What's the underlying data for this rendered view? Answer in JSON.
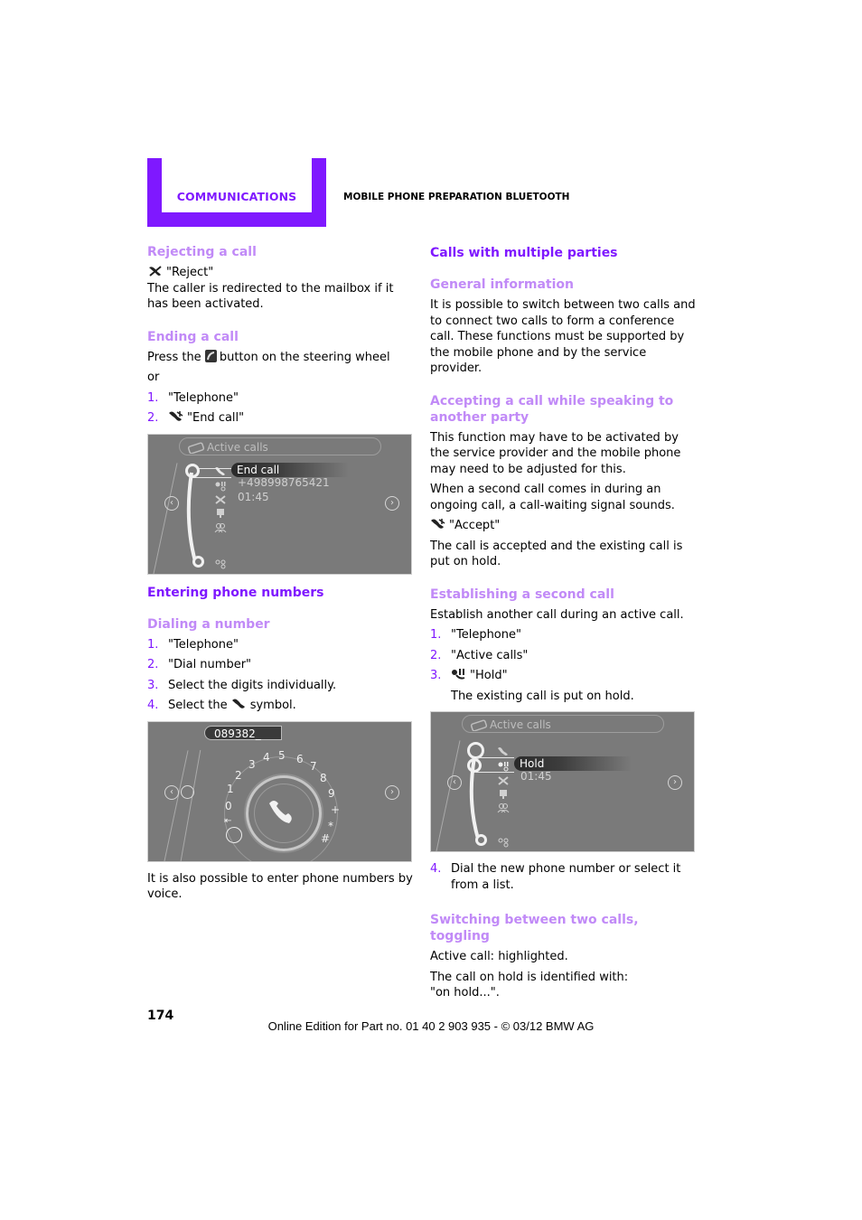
{
  "header": {
    "section": "COMMUNICATIONS",
    "chapter": "MOBILE PHONE PREPARATION BLUETOOTH",
    "accent_color": "#7f18ff",
    "subheading_color": "#c18af7"
  },
  "left": {
    "rejecting": {
      "title": "Rejecting a call",
      "icon": "reject-call-icon",
      "action": "\"Reject\"",
      "text": "The caller is redirected to the mailbox if it has been activated."
    },
    "ending": {
      "title": "Ending a call",
      "text_before": "Press the",
      "button_icon": "steering-wheel-phone-button-icon",
      "text_after": "button on the steering wheel",
      "or": "or",
      "steps": [
        {
          "num": "1.",
          "text": "\"Telephone\""
        },
        {
          "num": "2.",
          "icon": "end-call-icon",
          "text": "\"End call\""
        }
      ]
    },
    "screen1": {
      "title": "Active calls",
      "selected": "End call",
      "number": "+498998765421",
      "duration": "01:45"
    },
    "entering": {
      "title": "Entering phone numbers"
    },
    "dialing": {
      "title": "Dialing a number",
      "steps": [
        {
          "num": "1.",
          "text": "\"Telephone\""
        },
        {
          "num": "2.",
          "text": "\"Dial number\""
        },
        {
          "num": "3.",
          "text": "Select the digits individually."
        },
        {
          "num": "4.",
          "text_before": "Select the",
          "icon": "dial-handset-icon",
          "text_after": "symbol."
        }
      ]
    },
    "screen2": {
      "input_value": "089382_",
      "digits": [
        "0",
        "1",
        "2",
        "3",
        "4",
        "5",
        "6",
        "7",
        "8",
        "9",
        "+",
        "*",
        "#"
      ],
      "backspace": "⇤"
    },
    "voice_note": "It is also possible to enter phone numbers by voice."
  },
  "right": {
    "multi": {
      "title": "Calls with multiple parties"
    },
    "general": {
      "title": "General information",
      "text": "It is possible to switch between two calls and to connect two calls to form a conference call. These functions must be supported by the mobile phone and by the service provider."
    },
    "accepting": {
      "title": "Accepting a call while speaking to another party",
      "text1": "This function may have to be activated by the service provider and the mobile phone may need to be adjusted for this.",
      "text2": "When a second call comes in during an ongoing call, a call-waiting signal sounds.",
      "icon": "accept-call-icon",
      "action": "\"Accept\"",
      "text3": "The call is accepted and the existing call is put on hold."
    },
    "establishing": {
      "title": "Establishing a second call",
      "intro": "Establish another call during an active call.",
      "steps": [
        {
          "num": "1.",
          "text": "\"Telephone\""
        },
        {
          "num": "2.",
          "text": "\"Active calls\""
        },
        {
          "num": "3.",
          "icon": "hold-call-icon",
          "text": "\"Hold\""
        }
      ],
      "note": "The existing call is put on hold.",
      "step4": {
        "num": "4.",
        "text": "Dial the new phone number or select it from a list."
      }
    },
    "screen3": {
      "title": "Active calls",
      "selected": "Hold",
      "duration": "01:45"
    },
    "switching": {
      "title": "Switching between two calls, toggling",
      "text1": "Active call: highlighted.",
      "text2": "The call on hold is identified with:",
      "text3": "\"on hold...\"."
    }
  },
  "footer": {
    "page_number": "174",
    "edition": "Online Edition for Part no. 01 40 2 903 935 - © 03/12 BMW AG"
  }
}
